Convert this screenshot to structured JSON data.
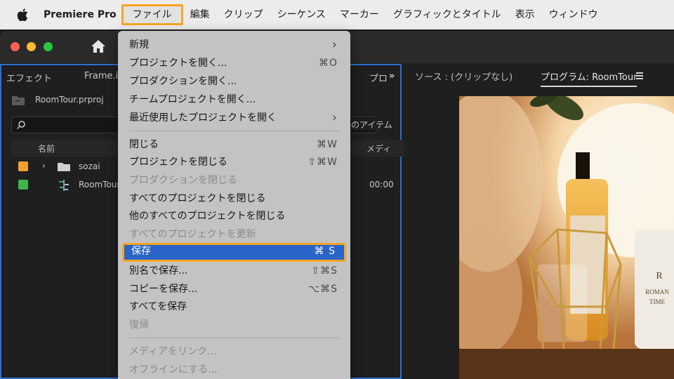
{
  "menubar": {
    "app_name": "Premiere Pro",
    "items": [
      "ファイル",
      "編集",
      "クリップ",
      "シーケンス",
      "マーカー",
      "グラフィックとタイトル",
      "表示",
      "ウィンドウ"
    ],
    "selected_index": 0,
    "highlight_color": "#f5a623"
  },
  "left_panel": {
    "tab_effects": "エフェクト",
    "tab_frameio": "Frame.io",
    "tab_project": "プロ",
    "tab_overflow": "»",
    "project_file": "RoomTour.prproj",
    "items_label": "のアイテム",
    "col_name": "名前",
    "col_media": "メディ",
    "rows": [
      {
        "color": "#f0a030",
        "label": "sozai",
        "value": ""
      },
      {
        "color": "#3fb34f",
        "label": "RoomTour",
        "value": "00:00"
      }
    ]
  },
  "right_panel": {
    "tab_source": "ソース : (クリップなし)",
    "tab_program": "プログラム: RoomTour"
  },
  "file_menu": {
    "items": [
      {
        "label": "新規",
        "shortcut": "›",
        "disabled": false
      },
      {
        "label": "プロジェクトを開く...",
        "shortcut": "⌘O",
        "disabled": false
      },
      {
        "label": "プロダクションを開く...",
        "shortcut": "",
        "disabled": false
      },
      {
        "label": "チームプロジェクトを開く...",
        "shortcut": "",
        "disabled": false
      },
      {
        "label": "最近使用したプロジェクトを開く",
        "shortcut": "›",
        "disabled": false
      },
      {
        "label": "閉じる",
        "shortcut": "⌘W",
        "disabled": false
      },
      {
        "label": "プロジェクトを閉じる",
        "shortcut": "⇧⌘W",
        "disabled": false
      },
      {
        "label": "プロダクションを閉じる",
        "shortcut": "",
        "disabled": true
      },
      {
        "label": "すべてのプロジェクトを閉じる",
        "shortcut": "",
        "disabled": false
      },
      {
        "label": "他のすべてのプロジェクトを閉じる",
        "shortcut": "",
        "disabled": false
      },
      {
        "label": "すべてのプロジェクトを更新",
        "shortcut": "",
        "disabled": true
      },
      {
        "label": "保存",
        "shortcut": "⌘ S",
        "disabled": false,
        "highlighted": true
      },
      {
        "label": "別名で保存...",
        "shortcut": "⇧⌘S",
        "disabled": false
      },
      {
        "label": "コピーを保存...",
        "shortcut": "⌥⌘S",
        "disabled": false
      },
      {
        "label": "すべてを保存",
        "shortcut": "",
        "disabled": false
      },
      {
        "label": "復帰",
        "shortcut": "",
        "disabled": true
      },
      {
        "label": "メディアをリンク...",
        "shortcut": "",
        "disabled": true
      },
      {
        "label": "オフラインにする...",
        "shortcut": "",
        "disabled": true
      }
    ]
  },
  "viewer": {
    "jar_label": "RO\nROMAN\nTIME"
  },
  "icons": {
    "apple": "apple-icon",
    "home": "home-icon",
    "search": "search-icon",
    "folder": "folder-icon",
    "sequence": "sequence-icon",
    "hamburger": "menu-icon"
  }
}
